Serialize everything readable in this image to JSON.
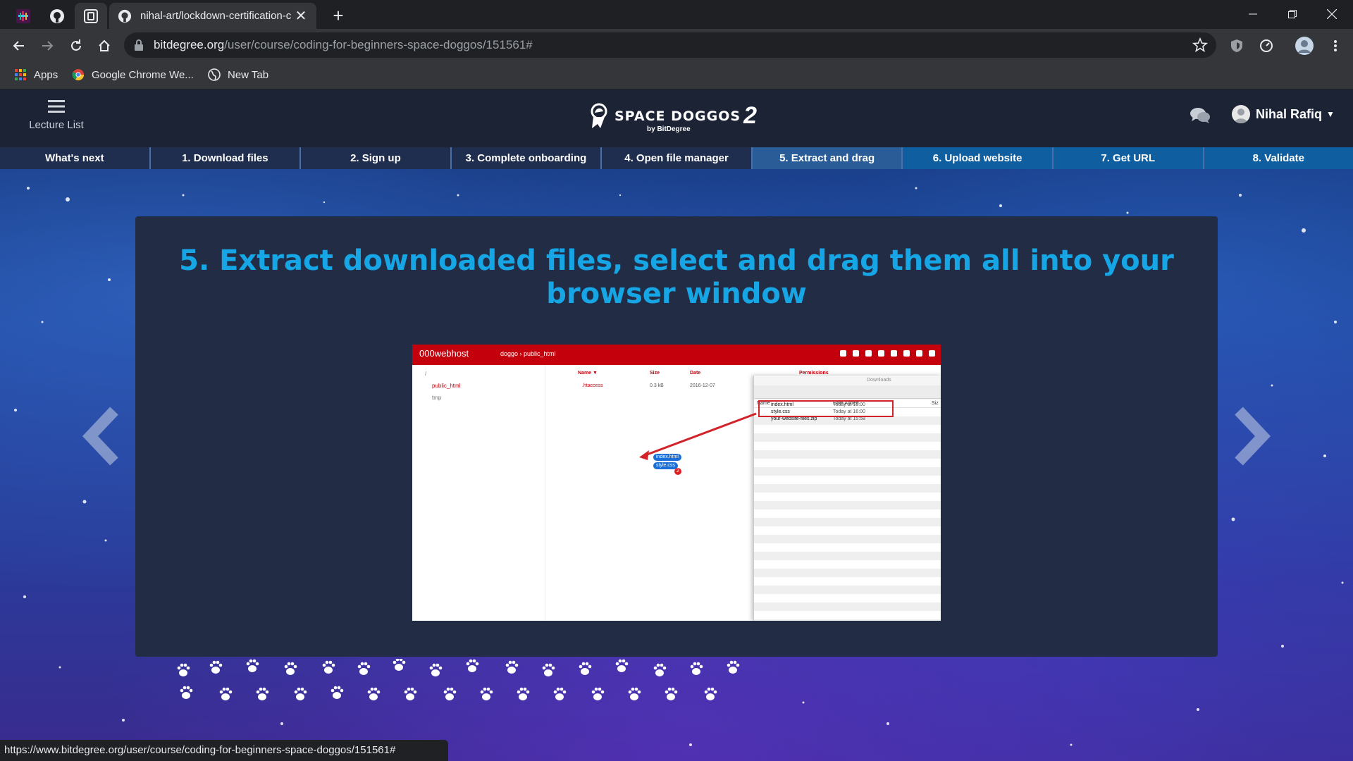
{
  "browser": {
    "tab_title": "nihal-art/lockdown-certification-c",
    "tab_close": "✕",
    "new_tab": "+",
    "url_host": "bitdegree.org",
    "url_path": "/user/course/coding-for-beginners-space-doggos/151561#",
    "bookmarks": [
      {
        "label": "Apps",
        "icon": "apps-grid-icon"
      },
      {
        "label": "Google Chrome We...",
        "icon": "chrome-icon"
      },
      {
        "label": "New Tab",
        "icon": "globe-icon"
      }
    ],
    "status_url": "https://www.bitdegree.org/user/course/coding-for-beginners-space-doggos/151561#"
  },
  "site": {
    "lecture_list": "Lecture List",
    "brand_name": "SPACE DOGGOS",
    "brand_number": "2",
    "brand_sub": "by BitDegree",
    "user_name": "Nihal Rafiq"
  },
  "steps": [
    {
      "label": "What's next",
      "state": "done"
    },
    {
      "label": "1. Download files",
      "state": "done"
    },
    {
      "label": "2. Sign up",
      "state": "done"
    },
    {
      "label": "3. Complete onboarding",
      "state": "done"
    },
    {
      "label": "4. Open file manager",
      "state": "done"
    },
    {
      "label": "5. Extract and drag",
      "state": "current"
    },
    {
      "label": "6. Upload website",
      "state": "todo"
    },
    {
      "label": "7. Get URL",
      "state": "todo"
    },
    {
      "label": "8. Validate",
      "state": "todo"
    }
  ],
  "lesson": {
    "title": "5. Extract downloaded files, select and drag them all into your browser window"
  },
  "illustration": {
    "host_logo": "000webhost",
    "crumb": "doggo › public_html",
    "tree": [
      "/",
      "public_html",
      "tmp"
    ],
    "list_headers": [
      "Name ▼",
      "Size",
      "Date",
      "Permissions"
    ],
    "list_row": {
      "name": ".htaccess",
      "size": "0.3 kB",
      "date": "2016-12-07"
    },
    "finder_title": "Downloads",
    "finder_headers": [
      "Name",
      "Date Added",
      "Siz"
    ],
    "finder_files": [
      {
        "name": "index.html",
        "date": "Today at 16:00"
      },
      {
        "name": "style.css",
        "date": "Today at 16:00"
      },
      {
        "name": "your-website-files.zip",
        "date": "Today at 15:58"
      }
    ],
    "drag_items": [
      "index.html",
      "style.css"
    ],
    "drag_count": "2"
  },
  "colors": {
    "title_blue": "#16a6e6",
    "card_bg": "#222c45",
    "header_bg": "#1b2335",
    "step_current": "#2a5d97",
    "host_red": "#c3000b"
  }
}
